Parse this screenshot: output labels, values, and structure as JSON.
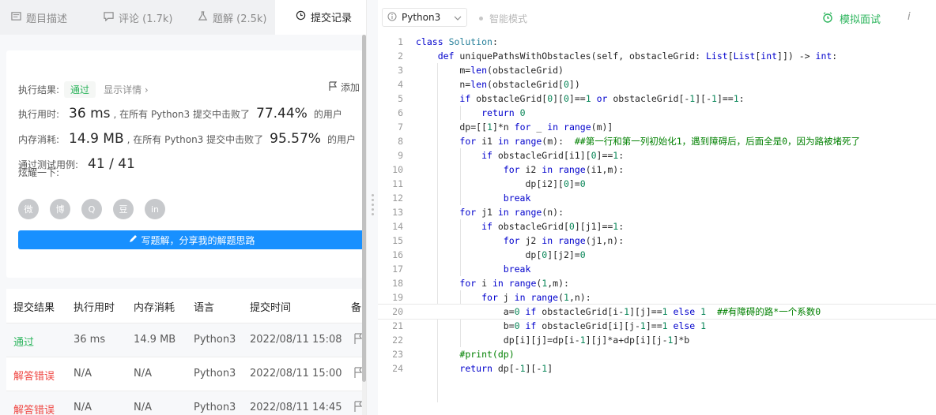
{
  "tabs": [
    {
      "label": "题目描述",
      "icon": "document-icon"
    },
    {
      "label": "评论 (1.7k)",
      "icon": "comment-icon"
    },
    {
      "label": "题解 (2.5k)",
      "icon": "flask-icon"
    },
    {
      "label": "提交记录",
      "icon": "clock-icon",
      "active": true
    }
  ],
  "result": {
    "label": "执行结果:",
    "status": "通过",
    "detail": "显示详情 ›",
    "add": "添加",
    "time_label": "执行用时:",
    "time_value": "36 ms",
    "time_mid": ", 在所有 Python3 提交中击败了",
    "time_pct": "77.44%",
    "time_tail": "的用户",
    "mem_label": "内存消耗:",
    "mem_value": "14.9 MB",
    "mem_mid": ", 在所有 Python3 提交中击败了",
    "mem_pct": "95.57%",
    "mem_tail": "的用户",
    "cases_label": "通过测试用例:",
    "cases_value": "41 / 41",
    "share_label": "炫耀一下:",
    "share_icons": [
      "wechat-icon",
      "weibo-icon",
      "qq-icon",
      "douban-icon",
      "linkedin-icon"
    ],
    "share_glyphs": [
      "微",
      "博",
      "Q",
      "豆",
      "in"
    ],
    "write_button": "写题解，分享我的解题思路"
  },
  "table": {
    "headers": [
      "提交结果",
      "执行用时",
      "内存消耗",
      "语言",
      "提交时间",
      "备"
    ],
    "rows": [
      {
        "status": "通过",
        "time": "36 ms",
        "memory": "14.9 MB",
        "lang": "Python3",
        "submitted": "2022/08/11 15:08",
        "kind": "ok"
      },
      {
        "status": "解答错误",
        "time": "N/A",
        "memory": "N/A",
        "lang": "Python3",
        "submitted": "2022/08/11 15:00",
        "kind": "err"
      },
      {
        "status": "解答错误",
        "time": "N/A",
        "memory": "N/A",
        "lang": "Python3",
        "submitted": "2022/08/11 14:45",
        "kind": "err"
      }
    ]
  },
  "toolbar": {
    "language": "Python3",
    "smart_mode": "智能模式",
    "mock_interview": "模拟面试",
    "info": "i"
  },
  "editor": {
    "lines": [
      "class Solution:",
      "    def uniquePathsWithObstacles(self, obstacleGrid: List[List[int]]) -> int:",
      "        m=len(obstacleGrid)",
      "        n=len(obstacleGrid[0])",
      "        if obstacleGrid[0][0]==1 or obstacleGrid[-1][-1]==1:",
      "            return 0",
      "        dp=[[1]*n for _ in range(m)]",
      "        for i1 in range(m):  ##第一行和第一列初始化1，遇到障碍后，后面全是0，因为路被堵死了",
      "            if obstacleGrid[i1][0]==1:",
      "                for i2 in range(i1,m):",
      "                    dp[i2][0]=0",
      "                break",
      "        for j1 in range(n):",
      "            if obstacleGrid[0][j1]==1:",
      "                for j2 in range(j1,n):",
      "                    dp[0][j2]=0",
      "                break",
      "        for i in range(1,m):",
      "            for j in range(1,n):",
      "                a=0 if obstacleGrid[i-1][j]==1 else 1  ##有障碍的路*一个系数0",
      "                b=0 if obstacleGrid[i][j-1]==1 else 1",
      "                dp[i][j]=dp[i-1][j]*a+dp[i][j-1]*b",
      "        #print(dp)",
      "        return dp[-1][-1]"
    ],
    "highlight_line": 20
  }
}
